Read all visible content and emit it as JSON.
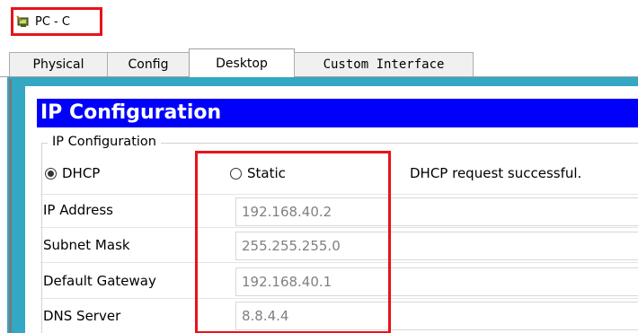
{
  "window": {
    "title": "PC - C",
    "icon": "pc-icon"
  },
  "tabs": [
    {
      "label": "Physical"
    },
    {
      "label": "Config"
    },
    {
      "label": "Desktop"
    },
    {
      "label": "Custom Interface"
    }
  ],
  "active_tab": "Desktop",
  "panel": {
    "title": "IP Configuration",
    "group_label": "IP Configuration",
    "dhcp_label": "DHCP",
    "static_label": "Static",
    "selected_mode": "DHCP",
    "status": "DHCP request successful.",
    "fields": [
      {
        "label": "IP Address",
        "value": "192.168.40.2"
      },
      {
        "label": "Subnet Mask",
        "value": "255.255.255.0"
      },
      {
        "label": "Default Gateway",
        "value": "192.168.40.1"
      },
      {
        "label": "DNS Server",
        "value": "8.8.4.4"
      }
    ]
  },
  "colors": {
    "header_bg": "#0101fb",
    "frame": "#33a7c4",
    "highlight": "#e8131a"
  }
}
